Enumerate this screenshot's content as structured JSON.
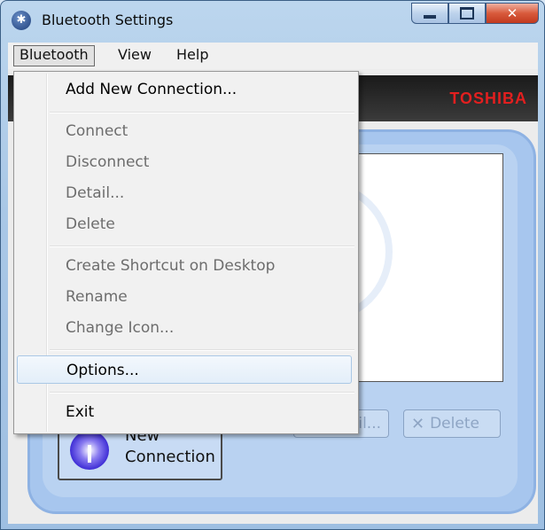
{
  "window": {
    "title": "Bluetooth Settings",
    "icon": "bluetooth-icon",
    "accent": "#a7c6ee"
  },
  "menubar": {
    "items": [
      "Bluetooth",
      "View",
      "Help"
    ],
    "active": "Bluetooth"
  },
  "brand": {
    "name": "TOSHIBA",
    "color": "#e21f1f"
  },
  "dropdown": {
    "items": [
      {
        "label": "Add New Connection...",
        "enabled": true
      },
      {
        "label": "Connect",
        "enabled": false
      },
      {
        "label": "Disconnect",
        "enabled": false
      },
      {
        "label": "Detail...",
        "enabled": false
      },
      {
        "label": "Delete",
        "enabled": false
      },
      {
        "label": "Create Shortcut on Desktop",
        "enabled": false
      },
      {
        "label": "Rename",
        "enabled": false
      },
      {
        "label": "Change Icon...",
        "enabled": false
      },
      {
        "label": "Options...",
        "enabled": true,
        "highlighted": true
      },
      {
        "label": "Exit",
        "enabled": true
      }
    ]
  },
  "main": {
    "new_connection_line1": "New",
    "new_connection_line2": "Connection",
    "detail_label": "ail...",
    "delete_label": "Delete"
  }
}
